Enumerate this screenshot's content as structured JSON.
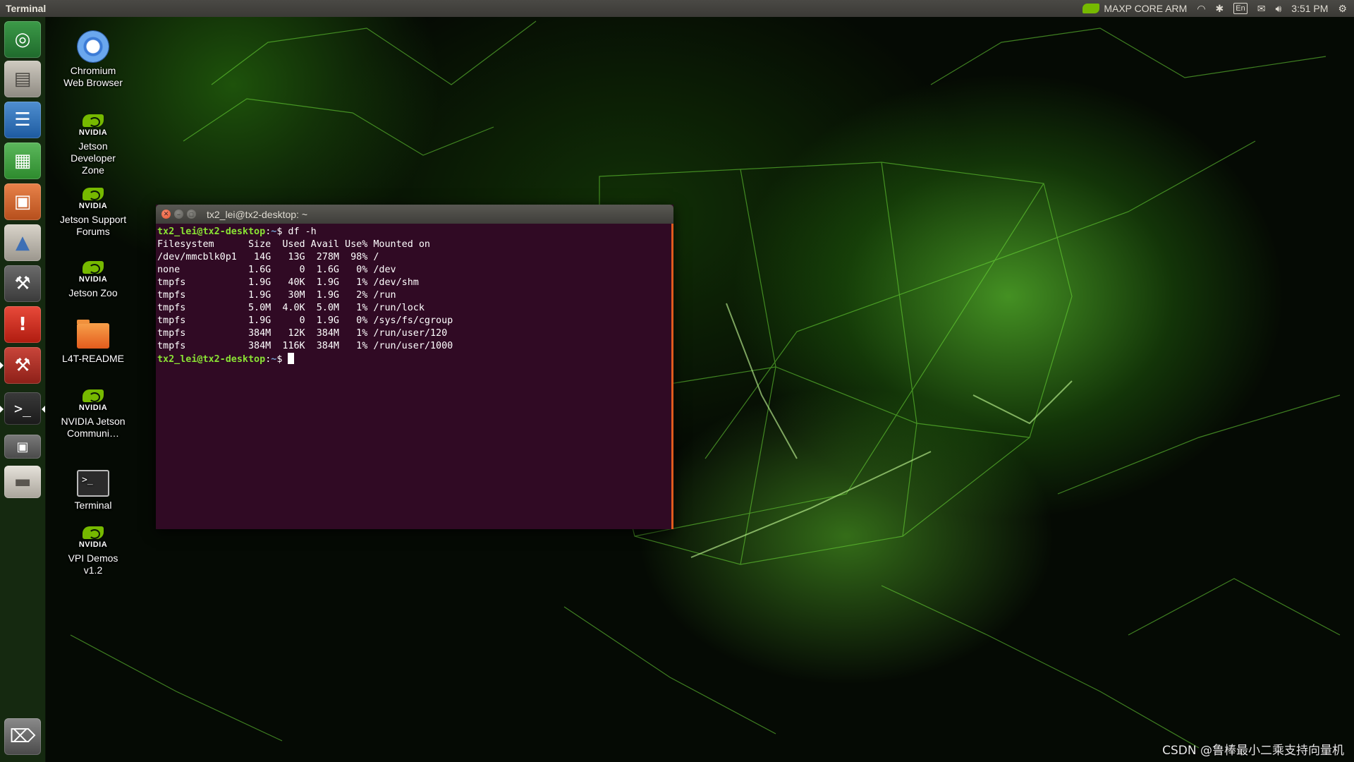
{
  "top_panel": {
    "app_title": "Terminal",
    "power_mode": "MAXP CORE ARM",
    "keyboard_layout": "En",
    "clock": "3:51 PM"
  },
  "launcher": {
    "items": [
      {
        "name": "chromium",
        "icon": "chromium-icon"
      },
      {
        "name": "files",
        "icon": "files-icon"
      },
      {
        "name": "libreoffice-writer",
        "icon": "document-icon"
      },
      {
        "name": "libreoffice-calc",
        "icon": "spreadsheet-icon"
      },
      {
        "name": "libreoffice-impress",
        "icon": "presentation-icon"
      },
      {
        "name": "software-center",
        "icon": "shopping-bag-icon"
      },
      {
        "name": "system-settings",
        "icon": "settings-tools-icon"
      },
      {
        "name": "error-report",
        "icon": "alert-icon"
      },
      {
        "name": "software-updater",
        "icon": "settings-tools-icon"
      },
      {
        "name": "terminal",
        "icon": "terminal-icon"
      },
      {
        "name": "screenshot",
        "icon": "camera-icon"
      },
      {
        "name": "drive",
        "icon": "drive-icon"
      },
      {
        "name": "trash",
        "icon": "trash-icon"
      }
    ]
  },
  "desktop": {
    "icons": [
      {
        "label": "Chromium Web Browser"
      },
      {
        "label": "Jetson Developer Zone",
        "brand": "NVIDIA"
      },
      {
        "label": "Jetson Support Forums",
        "brand": "NVIDIA"
      },
      {
        "label": "Jetson Zoo",
        "brand": "NVIDIA"
      },
      {
        "label": "L4T-README"
      },
      {
        "label": "NVIDIA Jetson Communi…",
        "brand": "NVIDIA"
      },
      {
        "label": "Terminal"
      },
      {
        "label": "VPI Demos v1.2",
        "brand": "NVIDIA"
      }
    ]
  },
  "terminal": {
    "window_title": "tx2_lei@tx2-desktop: ~",
    "prompt_user_host": "tx2_lei@tx2-desktop",
    "prompt_path": "~",
    "prompt_symbol": "$",
    "command": " df -h",
    "header": "Filesystem      Size  Used Avail Use% Mounted on",
    "rows": [
      "/dev/mmcblk0p1   14G   13G  278M  98% /",
      "none            1.6G     0  1.6G   0% /dev",
      "tmpfs           1.9G   40K  1.9G   1% /dev/shm",
      "tmpfs           1.9G   30M  1.9G   2% /run",
      "tmpfs           5.0M  4.0K  5.0M   1% /run/lock",
      "tmpfs           1.9G     0  1.9G   0% /sys/fs/cgroup",
      "tmpfs           384M   12K  384M   1% /run/user/120",
      "tmpfs           384M  116K  384M   1% /run/user/1000"
    ]
  },
  "watermark": "CSDN @鲁棒最小二乘支持向量机",
  "colors": {
    "terminal_bg": "#300a24",
    "prompt_user": "#8ae234",
    "prompt_path": "#729fcf",
    "nvidia_green": "#76b900",
    "close_button": "#e2532f"
  }
}
